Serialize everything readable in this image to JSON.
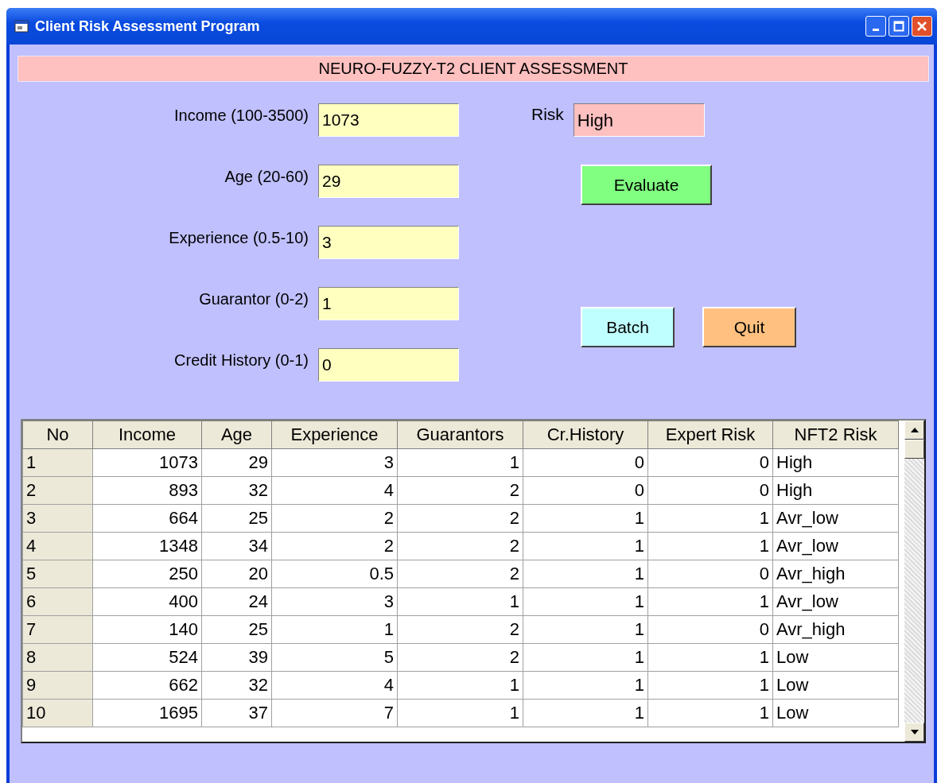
{
  "window": {
    "title": "Client Risk Assessment Program"
  },
  "header": "NEURO-FUZZY-T2 CLIENT ASSESSMENT",
  "inputs": [
    {
      "label": "Income (100-3500)",
      "value": "1073"
    },
    {
      "label": "Age (20-60)",
      "value": "29"
    },
    {
      "label": "Experience (0.5-10)",
      "value": "3"
    },
    {
      "label": "Guarantor (0-2)",
      "value": "1"
    },
    {
      "label": "Credit History (0-1)",
      "value": "0"
    }
  ],
  "risk": {
    "label": "Risk",
    "value": "High"
  },
  "buttons": [
    {
      "label": "Evaluate",
      "kind": "evaluate"
    },
    {
      "label": "Batch",
      "kind": "batch"
    },
    {
      "label": "Quit",
      "kind": "quit"
    }
  ],
  "table": {
    "columns": [
      "No",
      "Income",
      "Age",
      "Experience",
      "Guarantors",
      "Cr.History",
      "Expert Risk",
      "NFT2 Risk"
    ],
    "rows": [
      [
        "1",
        "1073",
        "29",
        "3",
        "1",
        "0",
        "0",
        "High"
      ],
      [
        "2",
        "893",
        "32",
        "4",
        "2",
        "0",
        "0",
        "High"
      ],
      [
        "3",
        "664",
        "25",
        "2",
        "2",
        "1",
        "1",
        "Avr_low"
      ],
      [
        "4",
        "1348",
        "34",
        "2",
        "2",
        "1",
        "1",
        "Avr_low"
      ],
      [
        "5",
        "250",
        "20",
        "0.5",
        "2",
        "1",
        "0",
        "Avr_high"
      ],
      [
        "6",
        "400",
        "24",
        "3",
        "1",
        "1",
        "1",
        "Avr_low"
      ],
      [
        "7",
        "140",
        "25",
        "1",
        "2",
        "1",
        "0",
        "Avr_high"
      ],
      [
        "8",
        "524",
        "39",
        "5",
        "2",
        "1",
        "1",
        "Low"
      ],
      [
        "9",
        "662",
        "32",
        "4",
        "1",
        "1",
        "1",
        "Low"
      ],
      [
        "10",
        "1695",
        "37",
        "7",
        "1",
        "1",
        "1",
        "Low"
      ]
    ]
  }
}
